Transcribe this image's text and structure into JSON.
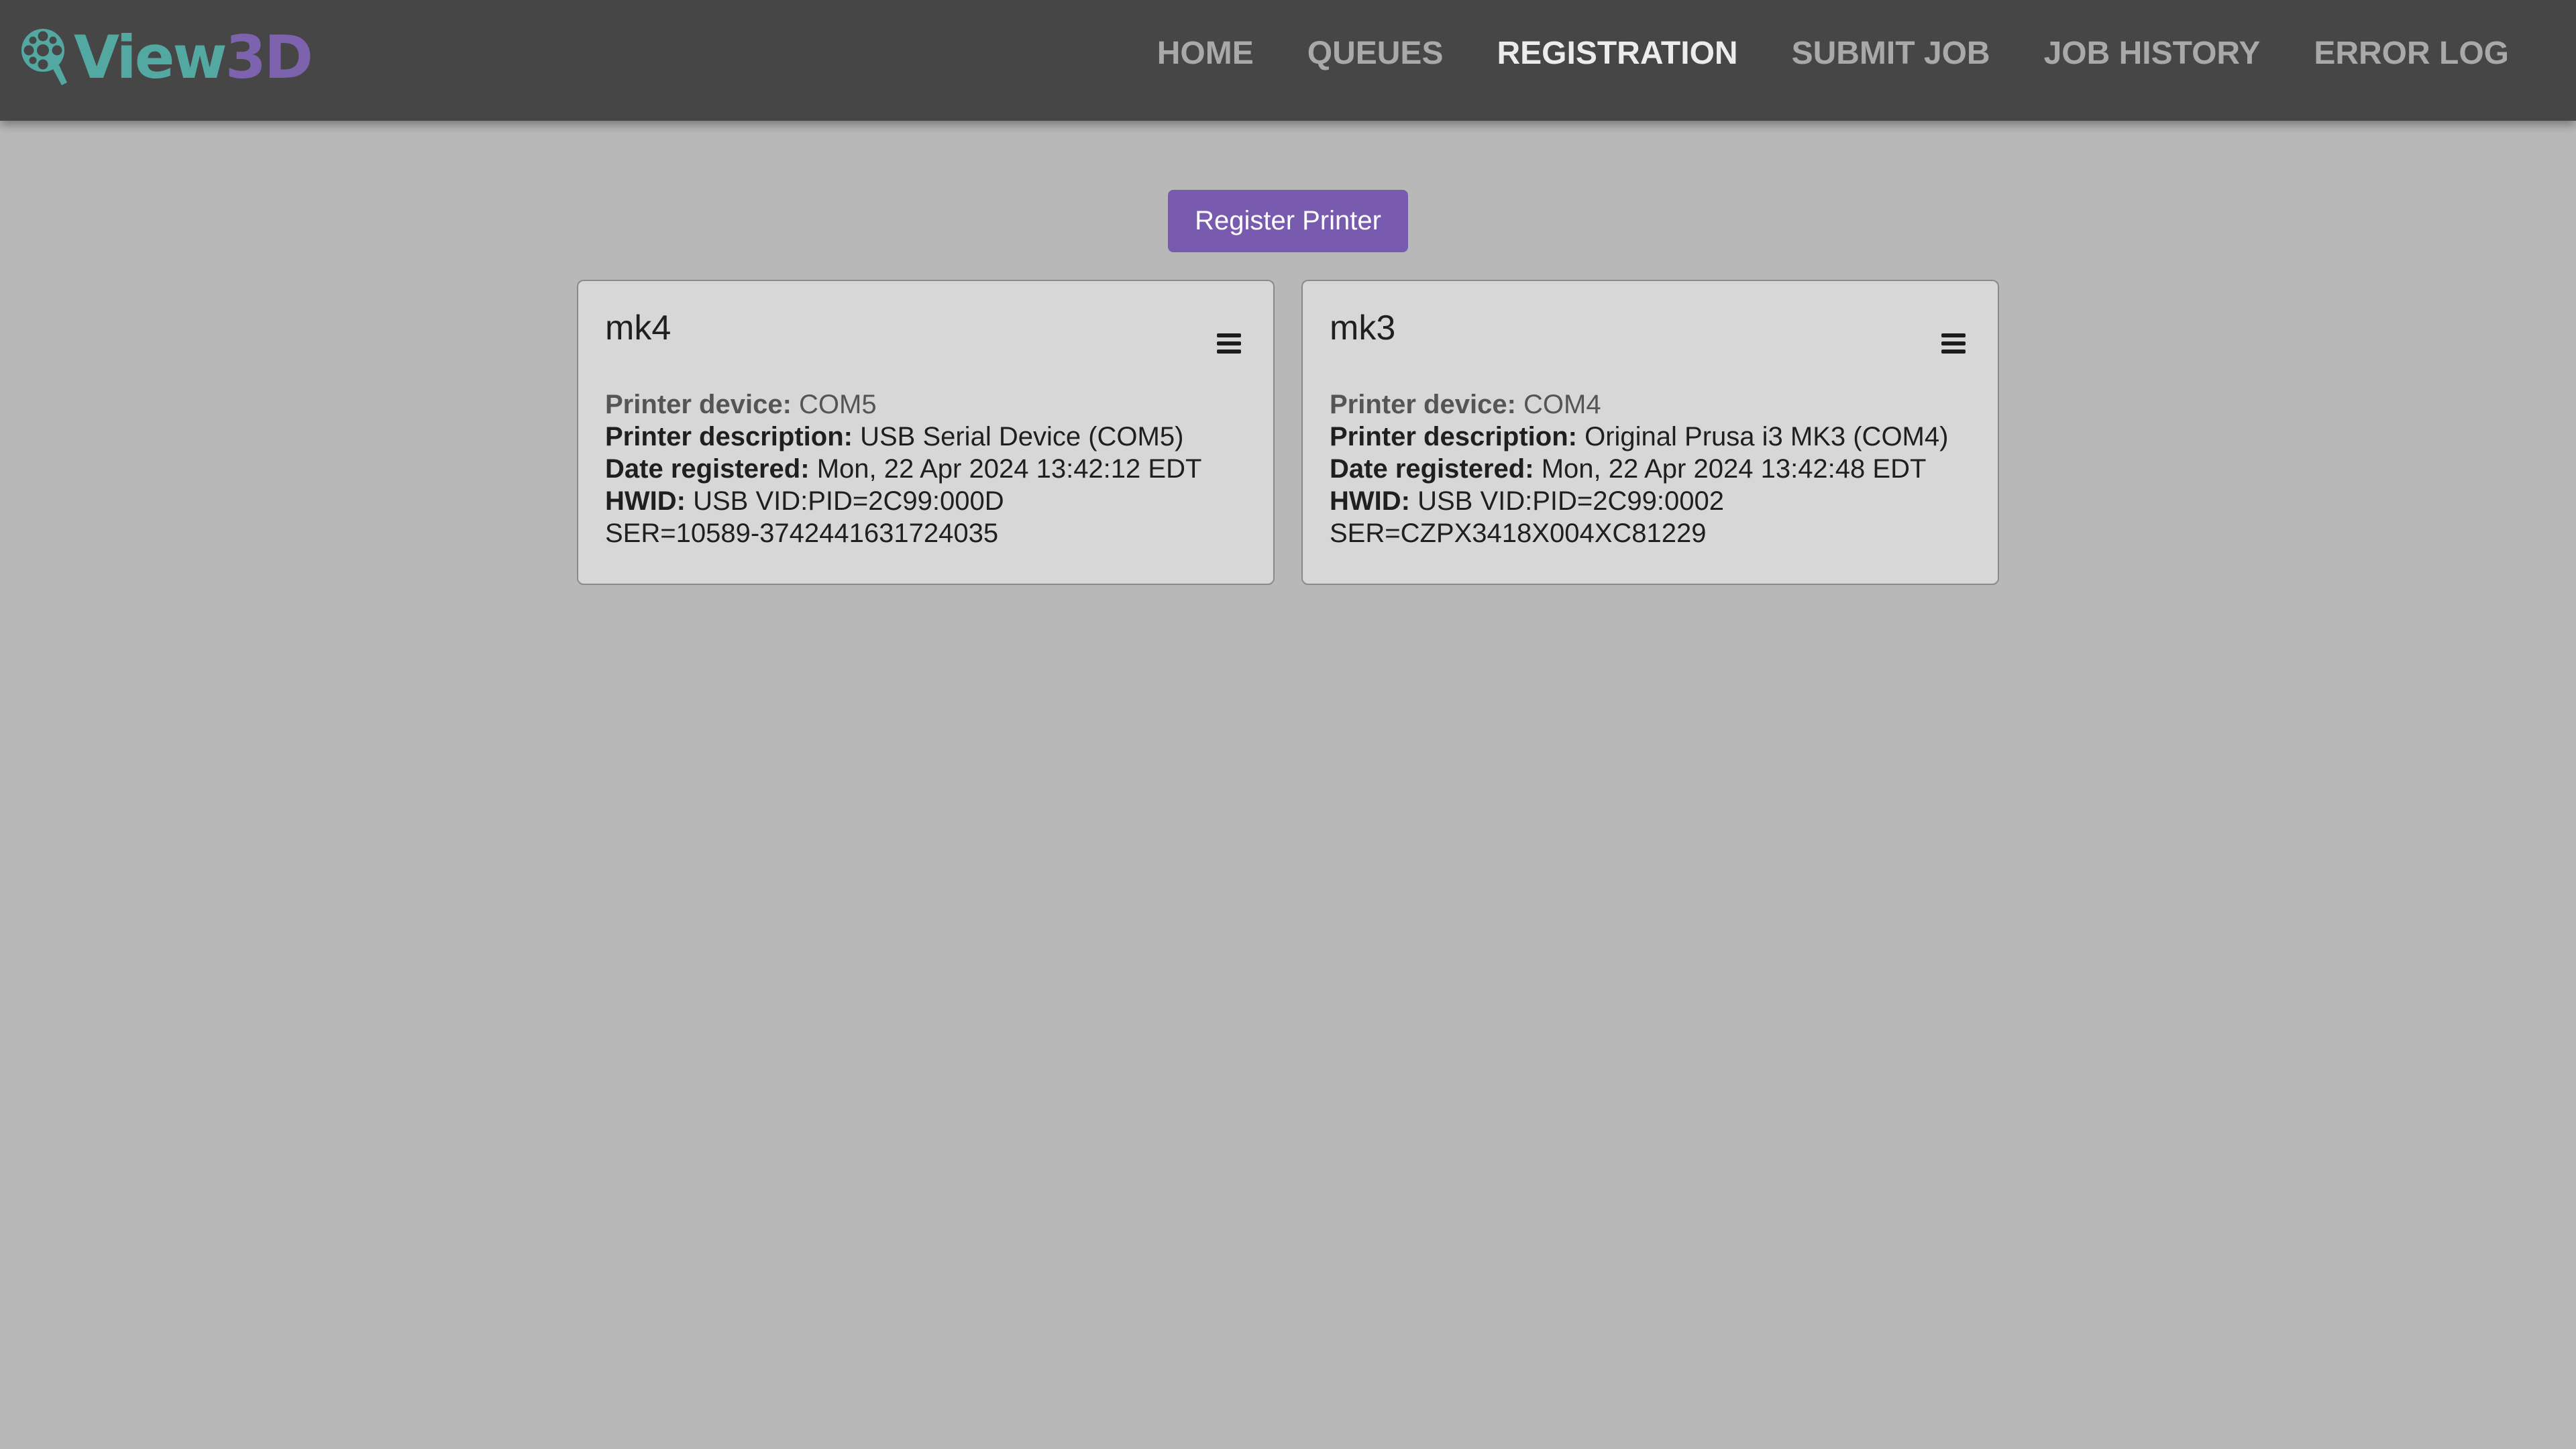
{
  "app": {
    "logo_view": "View",
    "logo_3d": "3D"
  },
  "nav": {
    "items": [
      {
        "label": "HOME",
        "active": false
      },
      {
        "label": "QUEUES",
        "active": false
      },
      {
        "label": "REGISTRATION",
        "active": true
      },
      {
        "label": "SUBMIT JOB",
        "active": false
      },
      {
        "label": "JOB HISTORY",
        "active": false
      },
      {
        "label": "ERROR LOG",
        "active": false
      }
    ]
  },
  "actions": {
    "register_label": "Register Printer"
  },
  "labels": {
    "device": "Printer device:",
    "description": "Printer description:",
    "date": "Date registered:",
    "hwid": "HWID:"
  },
  "printers": [
    {
      "name": "mk4",
      "device": "COM5",
      "description": "USB Serial Device (COM5)",
      "date_registered": "Mon, 22 Apr 2024 13:42:12 EDT",
      "hwid": "USB VID:PID=2C99:000D",
      "ser": "SER=10589-3742441631724035",
      "menu_icon": "hamburger-menu-icon"
    },
    {
      "name": "mk3",
      "device": "COM4",
      "description": "Original Prusa i3 MK3 (COM4)",
      "date_registered": "Mon, 22 Apr 2024 13:42:48 EDT",
      "hwid": "USB VID:PID=2C99:0002",
      "ser": "SER=CZPX3418X004XC81229",
      "menu_icon": "hamburger-menu-icon"
    }
  ],
  "colors": {
    "navbar_bg": "#464646",
    "page_bg": "#b8b8b8",
    "card_bg": "#d7d7d7",
    "accent_purple": "#785bae",
    "logo_teal": "#54a8a2",
    "logo_purple": "#7d62ad",
    "nav_active": "#ececec",
    "nav_inactive": "#a9a9a9"
  }
}
